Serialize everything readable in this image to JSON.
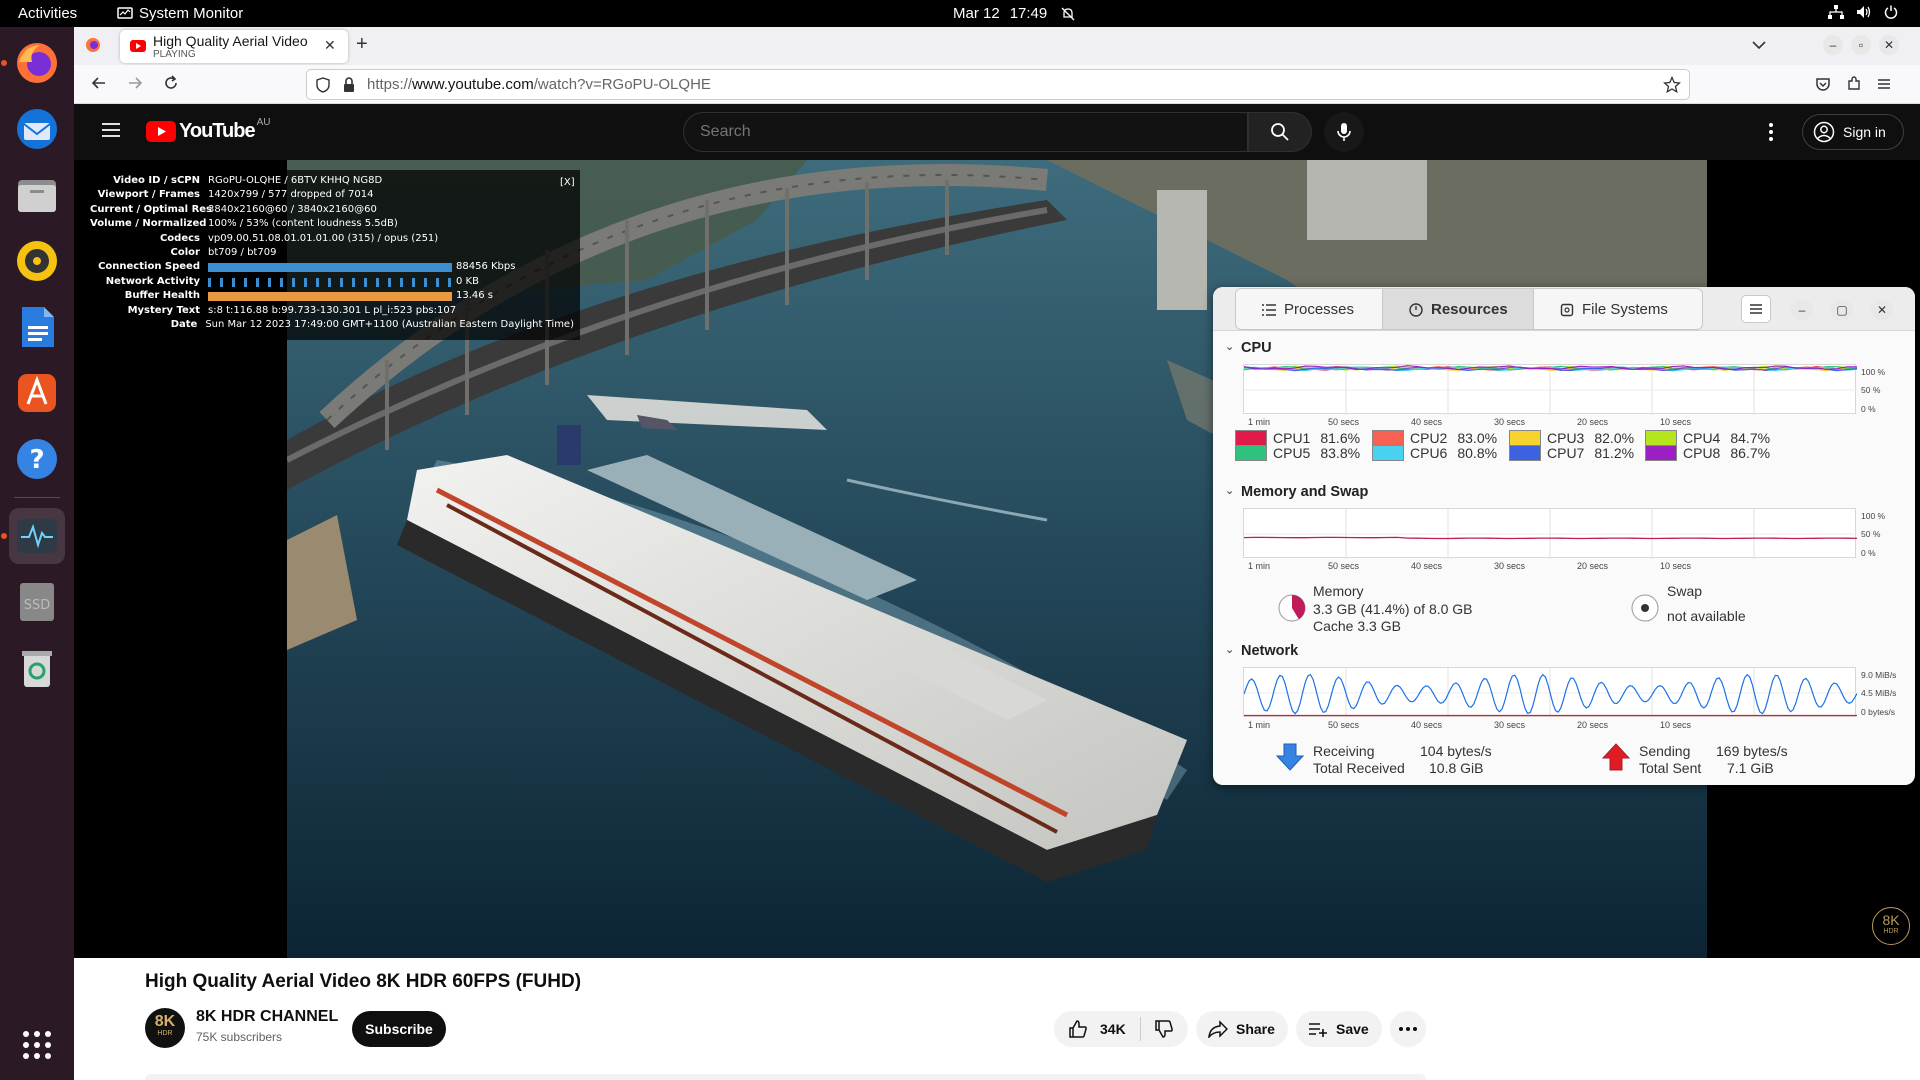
{
  "topbar": {
    "activities": "Activities",
    "app_name": "System Monitor",
    "date": "Mar 12",
    "time": "17:49"
  },
  "dock": {
    "items": [
      "firefox-icon",
      "thunderbird-icon",
      "files-icon",
      "rhythmbox-icon",
      "writer-icon",
      "app-center-icon",
      "help-icon",
      "system-monitor-icon",
      "ssd-drive-icon",
      "trash-icon",
      "show-apps-icon"
    ],
    "ssd_label": "SSD"
  },
  "browser": {
    "tab_title": "High Quality Aerial Video",
    "tab_status": "PLAYING",
    "url_prefix": "https://",
    "url_domain": "www.youtube.com",
    "url_path": "/watch?v=RGoPU-OLQHE"
  },
  "youtube": {
    "logo_text": "YouTube",
    "region": "AU",
    "search_placeholder": "Search",
    "sign_in": "Sign in",
    "video_title": "High Quality Aerial Video 8K HDR 60FPS (FUHD)",
    "channel_name": "8K HDR CHANNEL",
    "subscribers": "75K subscribers",
    "subscribe": "Subscribe",
    "likes": "34K",
    "share": "Share",
    "save": "Save",
    "avatar_text": "8K",
    "avatar_sub": "HDR"
  },
  "stats": {
    "close": "[X]",
    "rows": [
      {
        "label": "Video ID / sCPN",
        "value": "RGoPU-OLQHE  /  6BTV  KHHQ  NG8D"
      },
      {
        "label": "Viewport / Frames",
        "value": "1420x799 / 577 dropped of 7014"
      },
      {
        "label": "Current / Optimal Res",
        "value": "3840x2160@60 / 3840x2160@60"
      },
      {
        "label": "Volume / Normalized",
        "value": "100% / 53% (content loudness 5.5dB)"
      },
      {
        "label": "Codecs",
        "value": "vp09.00.51.08.01.01.01.00 (315) / opus (251)"
      },
      {
        "label": "Color",
        "value": "bt709 / bt709"
      },
      {
        "label": "Connection Speed",
        "value": "88456 Kbps"
      },
      {
        "label": "Network Activity",
        "value": "0 KB"
      },
      {
        "label": "Buffer Health",
        "value": "13.46 s"
      },
      {
        "label": "Mystery Text",
        "value": "s:8 t:116.88 b:99.733-130.301 L pl_i:523 pbs:107"
      },
      {
        "label": "Date",
        "value": "Sun Mar 12 2023 17:49:00 GMT+1100 (Australian Eastern Daylight Time)"
      }
    ]
  },
  "sysmon": {
    "tabs": [
      "Processes",
      "Resources",
      "File Systems"
    ],
    "time_ticks": [
      "1 min",
      "50 secs",
      "40 secs",
      "30 secs",
      "20 secs",
      "10 secs"
    ],
    "cpu": {
      "title": "CPU",
      "ylabels": [
        "100 %",
        "50 %",
        "0 %"
      ],
      "cores": [
        {
          "name": "CPU1",
          "value": "81.6%",
          "color": "#e01b4c"
        },
        {
          "name": "CPU2",
          "value": "83.0%",
          "color": "#f66151"
        },
        {
          "name": "CPU3",
          "value": "82.0%",
          "color": "#f6d32d"
        },
        {
          "name": "CPU4",
          "value": "84.7%",
          "color": "#b5e61d"
        },
        {
          "name": "CPU5",
          "value": "83.8%",
          "color": "#2ec27e"
        },
        {
          "name": "CPU6",
          "value": "80.8%",
          "color": "#48d1f0"
        },
        {
          "name": "CPU7",
          "value": "81.2%",
          "color": "#3c62e0"
        },
        {
          "name": "CPU8",
          "value": "86.7%",
          "color": "#9b1fc2"
        }
      ]
    },
    "memory": {
      "title": "Memory and Swap",
      "ylabels": [
        "100 %",
        "50 %",
        "0 %"
      ],
      "mem_label": "Memory",
      "mem_value": "3.3 GB (41.4%) of 8.0 GB",
      "mem_cache": "Cache 3.3 GB",
      "mem_fraction": 0.414,
      "swap_label": "Swap",
      "swap_value": "not available"
    },
    "network": {
      "title": "Network",
      "ylabels": [
        "9.0 MiB/s",
        "4.5 MiB/s",
        "0 bytes/s"
      ],
      "receiving_label": "Receiving",
      "receiving_value": "104 bytes/s",
      "total_received_label": "Total Received",
      "total_received_value": "10.8 GiB",
      "sending_label": "Sending",
      "sending_value": "169 bytes/s",
      "total_sent_label": "Total Sent",
      "total_sent_value": "7.1 GiB"
    }
  }
}
